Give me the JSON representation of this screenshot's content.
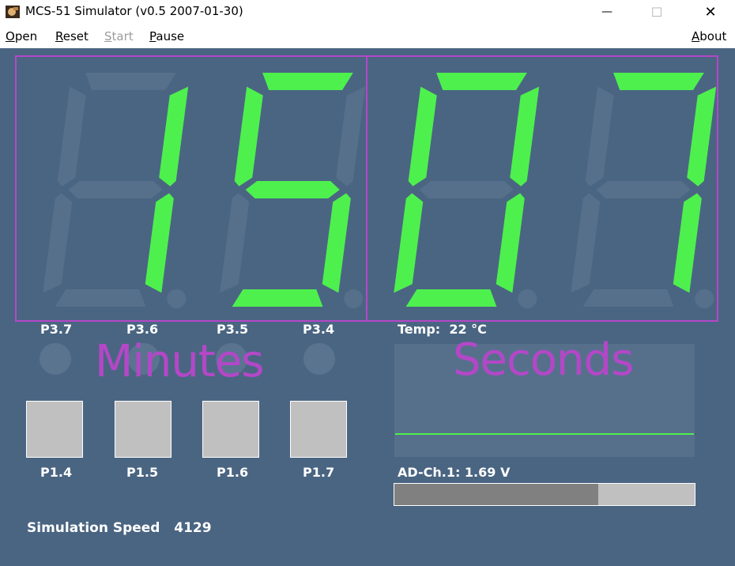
{
  "window": {
    "title": "MCS-51 Simulator (v0.5 2007-01-30)",
    "minimize_glyph": "—",
    "maximize_glyph": "☐",
    "close_glyph": "✕"
  },
  "menu": {
    "open": {
      "acc": "O",
      "rest": "pen"
    },
    "reset": {
      "acc": "R",
      "rest": "eset"
    },
    "start": {
      "acc": "S",
      "rest": "tart"
    },
    "pause": {
      "acc": "P",
      "rest": "ause"
    },
    "about": {
      "acc": "A",
      "rest": "bout"
    }
  },
  "display": {
    "digits": [
      "1",
      "5",
      "0",
      "7"
    ],
    "on_color": "#4ef04e",
    "off_color": "#56708c",
    "overlay_color": "#b447c8"
  },
  "port_labels_top": [
    "P3.7",
    "P3.6",
    "P3.5",
    "P3.4"
  ],
  "overlay_labels": {
    "minutes": "Minutes",
    "seconds": "Seconds"
  },
  "buttons": [
    "P1.4",
    "P1.5",
    "P1.6",
    "P1.7"
  ],
  "temperature": {
    "label": "Temp:",
    "value": "22 °C"
  },
  "ad": {
    "label": "AD-Ch.1: 1.69 V",
    "level": 0.68
  },
  "speed": {
    "label": "Simulation Speed",
    "value": "4129"
  }
}
